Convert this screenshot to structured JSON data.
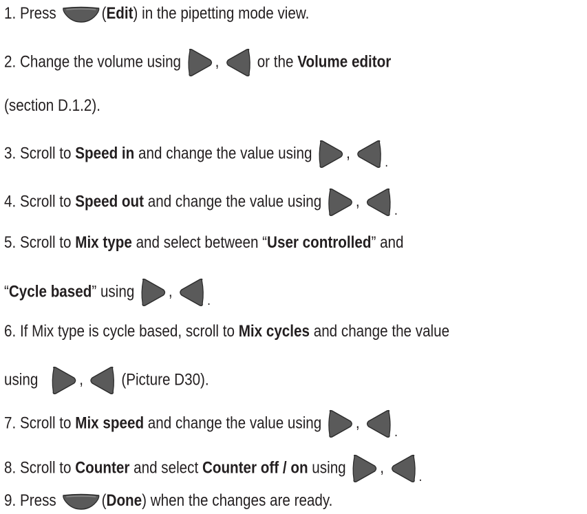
{
  "steps": [
    {
      "num": "1.",
      "t1": "Press",
      "t2": "(",
      "bold1": "Edit",
      "t3": ") in the pipetting mode view."
    },
    {
      "num": "2.",
      "t1": "Change the volume using",
      "sep": ",",
      "t2": "or the",
      "bold1": "Volume editor",
      "cont": "(section D.1.2)."
    },
    {
      "num": "3.",
      "t1": "Scroll to",
      "bold1": "Speed in",
      "t2": "and change the value using",
      "sep": ",",
      "end": "."
    },
    {
      "num": "4.",
      "t1": "Scroll to",
      "bold1": "Speed out",
      "t2": "and change the value using",
      "sep": ",",
      "end": "."
    },
    {
      "num": "5.",
      "t1": "Scroll to",
      "bold1": "Mix type",
      "t2": "and select between “",
      "bold2": "User controlled",
      "t3": "” and",
      "c1": "“",
      "cbold": "Cycle based",
      "c2": "” using",
      "sep": ",",
      "end": "."
    },
    {
      "num": "6.",
      "t1": "If Mix type is cycle based, scroll to",
      "bold1": "Mix cycles",
      "t2": "and change the value",
      "c1": "using",
      "sep": ",",
      "c2": "(Picture D30)."
    },
    {
      "num": "7.",
      "t1": "Scroll to",
      "bold1": "Mix speed",
      "t2": "and change the value using",
      "sep": ",",
      "end": "."
    },
    {
      "num": "8.",
      "t1": "Scroll to",
      "bold1": "Counter",
      "t2": "and select",
      "bold2": "Counter off / on",
      "t3": "using",
      "sep": ",",
      "end": "."
    },
    {
      "num": "9.",
      "t1": "Press",
      "t2": "(",
      "bold1": "Done",
      "t3": ") when the changes are ready."
    }
  ],
  "icons": {
    "edit": "soft-key-button-icon",
    "right": "right-arrow-button-icon",
    "left": "left-arrow-button-icon",
    "done": "soft-key-button-icon"
  },
  "colors": {
    "text": "#231f20",
    "button_fill": "#5a5a5a",
    "button_edge": "#2b2b2b"
  }
}
